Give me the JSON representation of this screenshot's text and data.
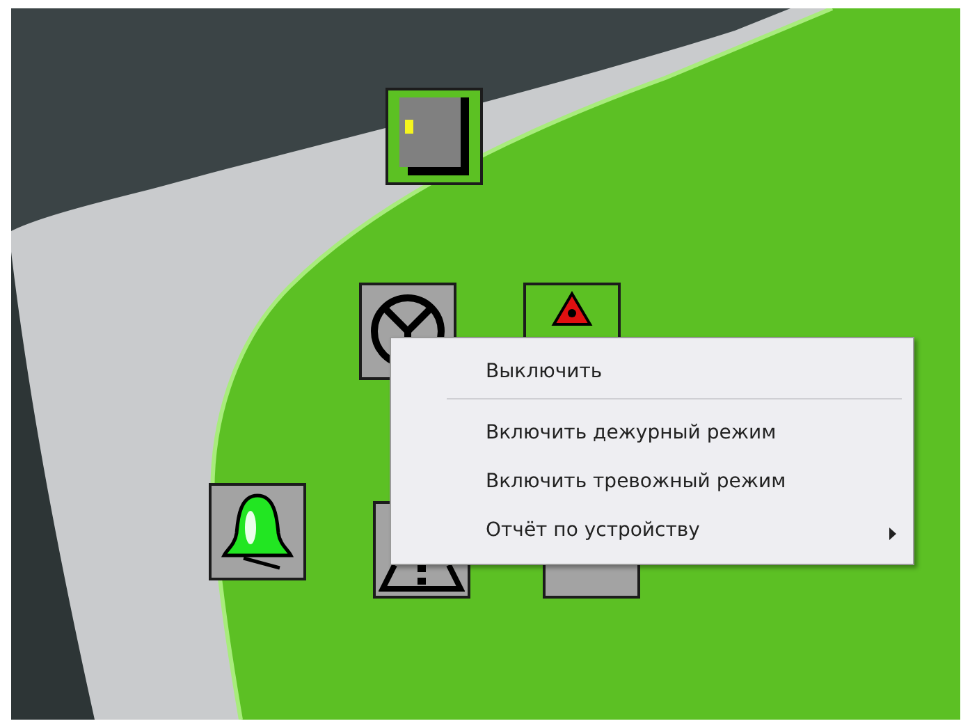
{
  "devices": [
    {
      "kind": "door",
      "color": "#5cc123"
    },
    {
      "kind": "valve",
      "color": "#a3a3a3"
    },
    {
      "kind": "siren",
      "color": "#5cc123"
    },
    {
      "kind": "bell",
      "color": "#a3a3a3"
    },
    {
      "kind": "warning",
      "color": "#a3a3a3"
    },
    {
      "kind": "box",
      "color": "#a3a3a3"
    }
  ],
  "context_menu": {
    "items": [
      {
        "kind": "item",
        "label": "Выключить"
      },
      {
        "kind": "separator"
      },
      {
        "kind": "item",
        "label": "Включить дежурный режим"
      },
      {
        "kind": "item",
        "label": "Включить тревожный режим"
      },
      {
        "kind": "submenu",
        "label": "Отчёт по устройству"
      }
    ]
  }
}
